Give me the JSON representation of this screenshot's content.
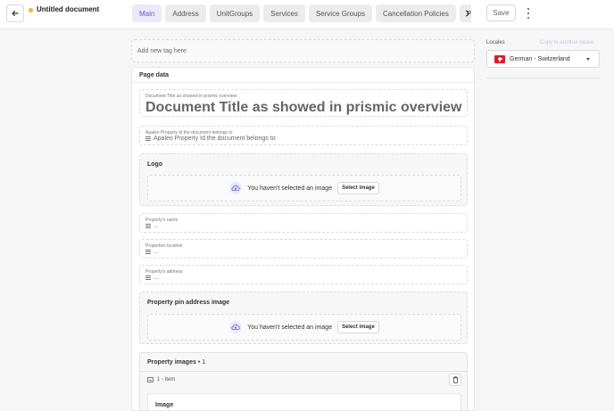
{
  "header": {
    "document_title": "Untitled document",
    "status_color": "#f1b434",
    "tabs": [
      {
        "label": "Main"
      },
      {
        "label": "Address"
      },
      {
        "label": "UnitGroups"
      },
      {
        "label": "Services"
      },
      {
        "label": "Service Groups"
      },
      {
        "label": "Cancellation Policies"
      },
      {
        "label": "Payment Policies"
      }
    ],
    "save_label": "Save"
  },
  "main": {
    "tag_placeholder": "Add new tag here",
    "card_title": "Page data",
    "doc_title_field": {
      "label": "Document Title as showed in prismic overview",
      "value": "Document Title as showed in prismic overview"
    },
    "property_id_field": {
      "label": "Apaleo Property Id the document belongs to",
      "placeholder": "Apaleo Property Id the document belongs to"
    },
    "logo": {
      "title": "Logo",
      "empty_text": "You haven't selected an image",
      "button_label": "Select image"
    },
    "property_name_field": {
      "label": "Property's name",
      "placeholder": "..."
    },
    "properties_location_field": {
      "label": "Properties location",
      "placeholder": "..."
    },
    "property_address_field": {
      "label": "Property's address",
      "placeholder": "..."
    },
    "pin_image": {
      "title": "Property pin address image",
      "empty_text": "You haven't selected an image",
      "button_label": "Select image"
    },
    "property_images": {
      "title": "Property images",
      "separator": " • ",
      "count": "1",
      "item_label": "1 - Item",
      "sub_title": "Image"
    }
  },
  "sidebar": {
    "locales_label": "Locales",
    "copy_label": "Copy to another locale",
    "selected_locale": "German - Switzerland",
    "accent_color": "#5b5bd6"
  }
}
